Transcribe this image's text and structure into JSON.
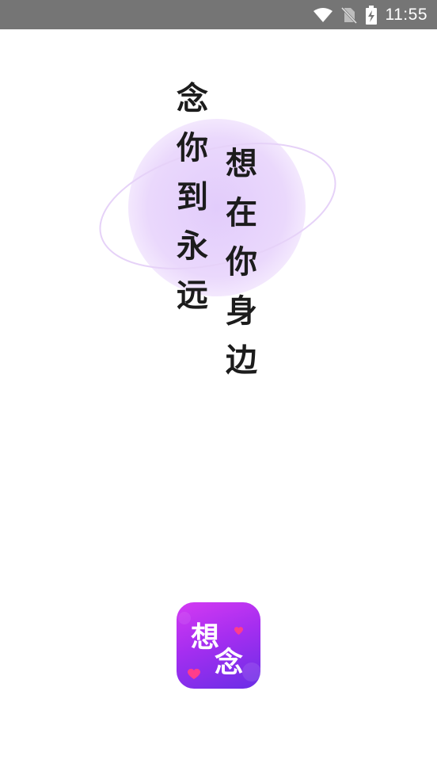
{
  "status_bar": {
    "time": "11:55",
    "icons": [
      "wifi-icon",
      "no-sim-icon",
      "battery-charging-icon"
    ],
    "background": "#757575"
  },
  "splash": {
    "line_left": [
      "念",
      "你",
      "到",
      "永",
      "远"
    ],
    "line_right": [
      "想",
      "在",
      "你",
      "身",
      "边"
    ],
    "accent_color": "#e2ccfb"
  },
  "app_logo": {
    "text": "想念",
    "gradient": [
      "#d43af2",
      "#6a2ee6"
    ],
    "heart_color": "#ff3d8b"
  }
}
